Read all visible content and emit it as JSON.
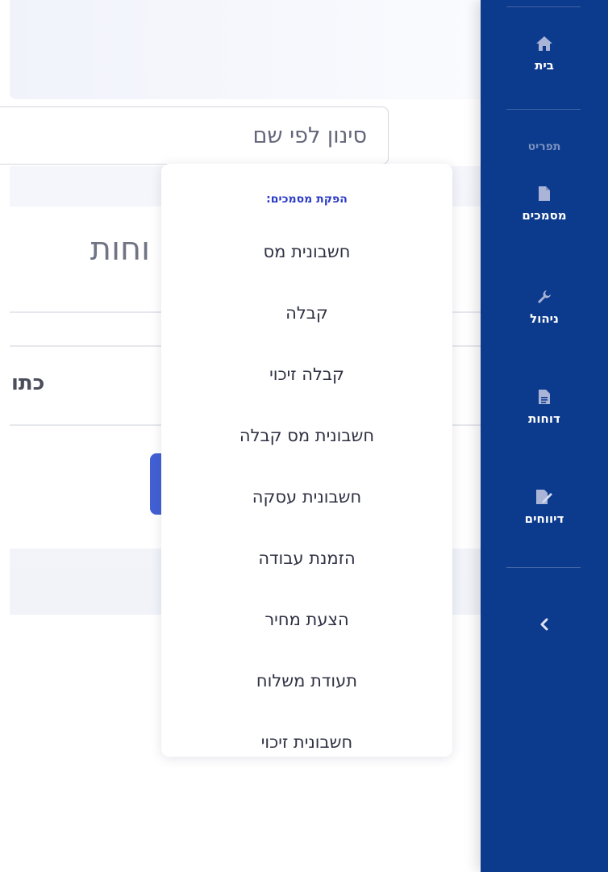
{
  "search": {
    "placeholder": "סינון לפי שם"
  },
  "page": {
    "title_partial": "וחות",
    "column_header_partial": "כתו"
  },
  "dropdown": {
    "header": "הפקת מסמכים:",
    "items": [
      "חשבונית מס",
      "קבלה",
      "קבלה זיכוי",
      "חשבונית מס קבלה",
      "חשבונית עסקה",
      "הזמנת עבודה",
      "הצעת מחיר",
      "תעודת משלוח",
      "חשבונית זיכוי"
    ]
  },
  "sidebar": {
    "home": {
      "label": "בית",
      "icon": "home-icon"
    },
    "section_title": "תפריט",
    "items": [
      {
        "label": "מסמכים",
        "icon": "document-icon"
      },
      {
        "label": "ניהול",
        "icon": "wrench-icon"
      },
      {
        "label": "דוחות",
        "icon": "report-icon"
      },
      {
        "label": "דיווחים",
        "icon": "edit-report-icon"
      }
    ],
    "collapse_icon": "chevron-left-icon"
  },
  "colors": {
    "sidebar_bg": "#0c3a8d",
    "dropdown_header": "#2c3bc6",
    "accent_button": "#4260d4"
  }
}
